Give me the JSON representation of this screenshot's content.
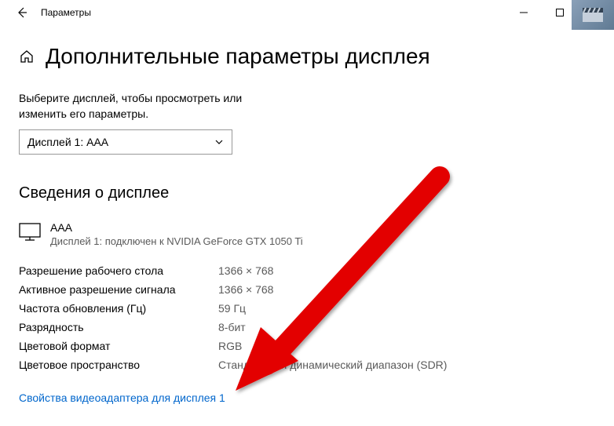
{
  "window": {
    "title": "Параметры"
  },
  "header": {
    "page_title": "Дополнительные параметры дисплея"
  },
  "instruction": "Выберите дисплей, чтобы просмотреть или изменить его параметры.",
  "display_select": {
    "selected": "Дисплей 1: AAA"
  },
  "section_title": "Сведения о дисплее",
  "display_info": {
    "name": "AAA",
    "sub": "Дисплей 1: подключен к NVIDIA GeForce GTX 1050 Ti"
  },
  "rows": [
    {
      "label": "Разрешение рабочего стола",
      "value": "1366 × 768"
    },
    {
      "label": "Активное разрешение сигнала",
      "value": "1366 × 768"
    },
    {
      "label": "Частота обновления (Гц)",
      "value": "59 Гц"
    },
    {
      "label": "Разрядность",
      "value": "8-бит"
    },
    {
      "label": "Цветовой формат",
      "value": "RGB"
    },
    {
      "label": "Цветовое пространство",
      "value": "Стандартный динамический диапазон (SDR)"
    }
  ],
  "link_label": "Свойства видеоадаптера для дисплея 1"
}
